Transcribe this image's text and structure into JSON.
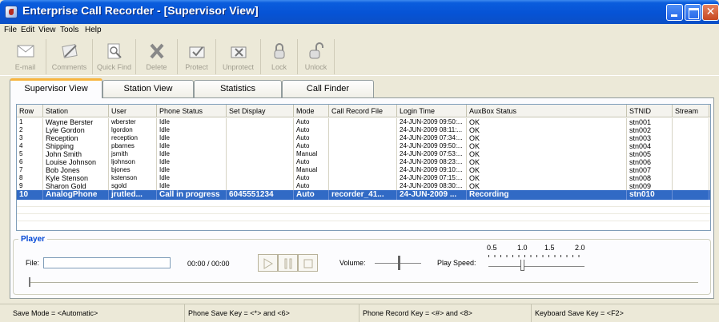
{
  "window": {
    "title": "Enterprise Call Recorder - [Supervisor View]",
    "close_glyph": "✕"
  },
  "menu": [
    "File",
    "Edit",
    "View",
    "Tools",
    "Help"
  ],
  "toolbar": [
    {
      "label": "E-mail",
      "icon": "envelope-icon"
    },
    {
      "label": "Comments",
      "icon": "comments-icon"
    },
    {
      "label": "Quick Find",
      "icon": "quick-find-icon"
    },
    {
      "label": "Delete",
      "icon": "delete-icon"
    },
    {
      "label": "Protect",
      "icon": "protect-icon"
    },
    {
      "label": "Unprotect",
      "icon": "unprotect-icon"
    },
    {
      "label": "Lock",
      "icon": "lock-icon"
    },
    {
      "label": "Unlock",
      "icon": "unlock-icon"
    }
  ],
  "tabs": [
    "Supervisor View",
    "Station View",
    "Statistics",
    "Call Finder"
  ],
  "active_tab": "Supervisor View",
  "grid": {
    "columns": [
      "Row",
      "Station",
      "User",
      "Phone Status",
      "Set Display",
      "Mode",
      "Call Record File",
      "Login Time",
      "AuxBox Status",
      "STNID",
      "Stream"
    ],
    "rows": [
      [
        "1",
        "Wayne Berster",
        "wberster",
        "Idle",
        "",
        "Auto",
        "",
        "24-JUN-2009 09:50:...",
        "OK",
        "stn001",
        ""
      ],
      [
        "2",
        "Lyle Gordon",
        "lgordon",
        "Idle",
        "",
        "Auto",
        "",
        "24-JUN-2009 08:11:...",
        "OK",
        "stn002",
        ""
      ],
      [
        "3",
        "Reception",
        "reception",
        "Idle",
        "",
        "Auto",
        "",
        "24-JUN-2009 07:34:...",
        "OK",
        "stn003",
        ""
      ],
      [
        "4",
        "Shipping",
        "pbarnes",
        "Idle",
        "",
        "Auto",
        "",
        "24-JUN-2009 09:50:...",
        "OK",
        "stn004",
        ""
      ],
      [
        "5",
        "John Smith",
        "jsmith",
        "Idle",
        "",
        "Manual",
        "",
        "24-JUN-2009 07:53:...",
        "OK",
        "stn005",
        ""
      ],
      [
        "6",
        "Louise Johnson",
        "ljohnson",
        "Idle",
        "",
        "Auto",
        "",
        "24-JUN-2009 08:23:...",
        "OK",
        "stn006",
        ""
      ],
      [
        "7",
        "Bob Jones",
        "bjones",
        "Idle",
        "",
        "Manual",
        "",
        "24-JUN-2009 09:10:...",
        "OK",
        "stn007",
        ""
      ],
      [
        "8",
        "Kyle Stenson",
        "kstenson",
        "Idle",
        "",
        "Auto",
        "",
        "24-JUN-2009 07:15:...",
        "OK",
        "stn008",
        ""
      ],
      [
        "9",
        "Sharon Gold",
        "sgold",
        "Idle",
        "",
        "Auto",
        "",
        "24-JUN-2009 08:30:...",
        "OK",
        "stn009",
        ""
      ],
      [
        "10",
        "AnalogPhone",
        "jrutled...",
        "Call in progress",
        "6045551234",
        "Auto",
        "recorder_41...",
        "24-JUN-2009 ...",
        "Recording",
        "stn010",
        ""
      ]
    ],
    "selected_row": 10
  },
  "player": {
    "title": "Player",
    "file_label": "File:",
    "file_value": "",
    "time": "00:00 / 00:00",
    "volume_label": "Volume:",
    "speed_label": "Play Speed:",
    "speed_ticks": [
      "0.5",
      "1.0",
      "1.5",
      "2.0"
    ],
    "speed_value": 1.0,
    "volume_value": 0.5,
    "seek_value": 0
  },
  "status": [
    "Save Mode = <Automatic>",
    "Phone Save Key = <*> and <6>",
    "Phone Record Key = <#> and <8>",
    "Keyboard Save Key = <F2>"
  ]
}
